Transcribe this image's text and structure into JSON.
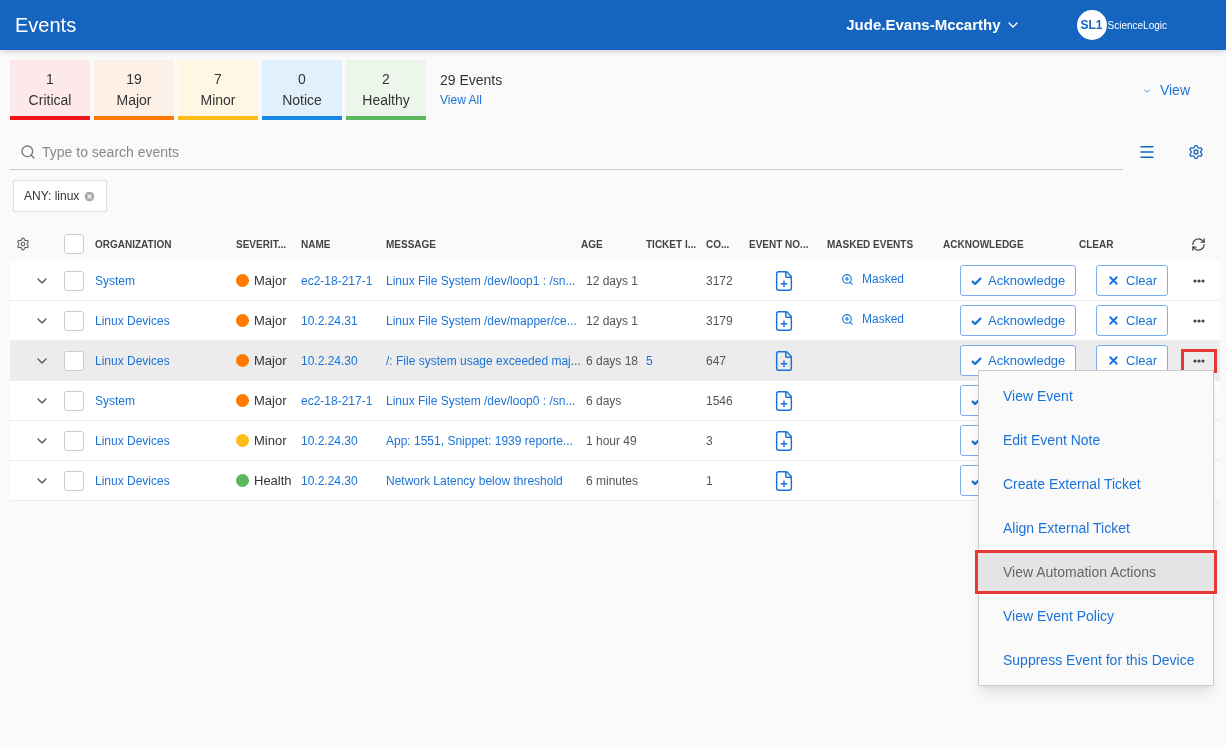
{
  "header": {
    "title": "Events",
    "user": "Jude.Evans-Mccarthy",
    "logo_mark": "SL1",
    "logo_text": "ScienceLogic"
  },
  "summary": {
    "tiles": [
      {
        "kind": "critical",
        "count": "1",
        "label": "Critical",
        "color": "#f0151d"
      },
      {
        "kind": "major",
        "count": "19",
        "label": "Major",
        "color": "#ff7a00"
      },
      {
        "kind": "minor",
        "count": "7",
        "label": "Minor",
        "color": "#fbbd16"
      },
      {
        "kind": "notice",
        "count": "0",
        "label": "Notice",
        "color": "#1a88e5"
      },
      {
        "kind": "healthy",
        "count": "2",
        "label": "Healthy",
        "color": "#5cb85c"
      }
    ],
    "total": "29 Events",
    "view_all": "View All",
    "view": "View"
  },
  "search": {
    "placeholder": "Type to search events"
  },
  "filters": [
    {
      "label": "ANY: linux"
    }
  ],
  "table": {
    "select_all_checked": false,
    "columns": [
      "ORGANIZATION",
      "SEVERIT...",
      "NAME",
      "MESSAGE",
      "AGE",
      "TICKET I...",
      "CO...",
      "EVENT NO...",
      "MASKED EVENTS",
      "ACKNOWLEDGE",
      "CLEAR"
    ],
    "rows": [
      {
        "selected": false,
        "checked": false,
        "organization": "System",
        "severity": "Major",
        "color": "#ff7a00",
        "name": "ec2-18-217-1",
        "message": "Linux File System /dev/loop1 : /sn...",
        "age": "12 days 1",
        "count": "3172",
        "masked": "Masked",
        "acknowledge": "Acknowledge",
        "clear": "Clear",
        "highlighted": false
      },
      {
        "selected": false,
        "checked": false,
        "organization": "Linux Devices",
        "severity": "Major",
        "color": "#ff7a00",
        "name": "10.2.24.31",
        "message": "Linux File System /dev/mapper/ce...",
        "age": "12 days 1",
        "count": "3179",
        "masked": "Masked",
        "acknowledge": "Acknowledge",
        "clear": "Clear",
        "highlighted": false
      },
      {
        "selected": true,
        "checked": false,
        "organization": "Linux Devices",
        "severity": "Major",
        "color": "#ff7a00",
        "name": "10.2.24.30",
        "message": "/: File system usage exceeded maj...",
        "age": "6 days 18",
        "ticket": "5",
        "count": "647",
        "acknowledge": "Acknowledge",
        "clear": "Clear",
        "highlighted": true
      },
      {
        "selected": false,
        "checked": false,
        "organization": "System",
        "severity": "Major",
        "color": "#ff7a00",
        "name": "ec2-18-217-1",
        "message": "Linux File System /dev/loop0 : /sn...",
        "age": "6 days",
        "count": "1546",
        "highlighted": false
      },
      {
        "selected": false,
        "checked": false,
        "organization": "Linux Devices",
        "severity": "Minor",
        "color": "#fbbd16",
        "name": "10.2.24.30",
        "message": "App: 1551, Snippet: 1939 reporte...",
        "age": "1 hour 49",
        "count": "3",
        "highlighted": false
      },
      {
        "selected": false,
        "checked": false,
        "organization": "Linux Devices",
        "severity": "Health",
        "color": "#5cb85c",
        "name": "10.2.24.30",
        "message": "Network Latency below threshold",
        "age": "6 minutes",
        "count": "1",
        "highlighted": false
      }
    ]
  },
  "menu": {
    "items": [
      {
        "label": "View Event",
        "selected": false,
        "highlighted": false
      },
      {
        "label": "Edit Event Note",
        "selected": false,
        "highlighted": false
      },
      {
        "label": "Create External Ticket",
        "selected": false,
        "highlighted": false
      },
      {
        "label": "Align External Ticket",
        "selected": false,
        "highlighted": false
      },
      {
        "label": "View Automation Actions",
        "selected": true,
        "highlighted": true
      },
      {
        "label": "View Event Policy",
        "selected": false,
        "highlighted": false
      },
      {
        "label": "Suppress Event for this Device",
        "selected": false,
        "highlighted": false
      }
    ]
  }
}
